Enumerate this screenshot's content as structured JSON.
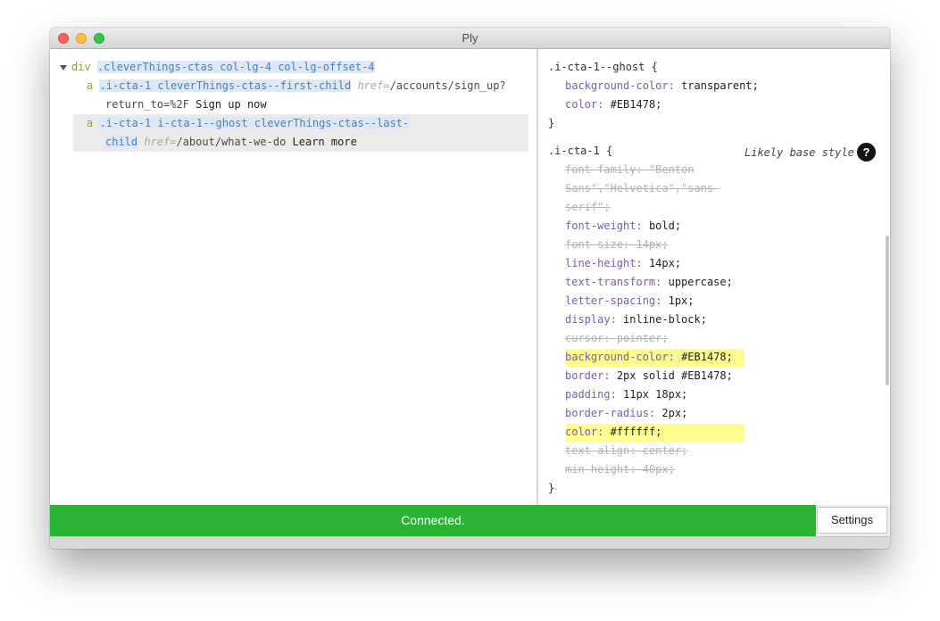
{
  "window": {
    "title": "Ply"
  },
  "dom_tree": {
    "root": {
      "tag": "div",
      "classes": ".cleverThings-ctas col-lg-4 col-lg-offset-4"
    },
    "child1": {
      "tag": "a",
      "classes": ".i-cta-1 cleverThings-ctas--first-child",
      "href_key": "href=",
      "href_val_1": "/accounts/sign_up?",
      "href_val_2": "return_to=%2F",
      "text": "Sign up now"
    },
    "child2": {
      "tag": "a",
      "classes_1": ".i-cta-1 i-cta-1--ghost cleverThings-ctas--last-",
      "classes_2": "child",
      "href_key": "href=",
      "href_val": "/about/what-we-do",
      "text": "Learn more"
    }
  },
  "styles": {
    "rule1": {
      "selector": ".i-cta-1--ghost {",
      "decls": [
        {
          "prop": "background-color:",
          "val": "transparent;"
        },
        {
          "prop": "color:",
          "val": "#EB1478;"
        }
      ],
      "close": "}"
    },
    "rule2": {
      "selector": ".i-cta-1 {",
      "note": "Likely base style",
      "help": "?",
      "font_family_1": "font-family: \"Benton",
      "font_family_2": "Sans\",\"Helvetica\",\"sans-",
      "font_family_3": "serif\";",
      "decls": [
        {
          "prop": "font-weight:",
          "val": "bold;"
        },
        {
          "prop": "font-size:",
          "val": "14px;"
        },
        {
          "prop": "line-height:",
          "val": "14px;"
        },
        {
          "prop": "text-transform:",
          "val": "uppercase;"
        },
        {
          "prop": "letter-spacing:",
          "val": "1px;"
        },
        {
          "prop": "display:",
          "val": "inline-block;"
        },
        {
          "prop": "cursor:",
          "val": "pointer;"
        },
        {
          "prop": "background-color:",
          "val": "#EB1478;"
        },
        {
          "prop": "border:",
          "val": "2px solid #EB1478;"
        },
        {
          "prop": "padding:",
          "val": "11px 18px;"
        },
        {
          "prop": "border-radius:",
          "val": "2px;"
        },
        {
          "prop": "color:",
          "val": "#ffffff;"
        },
        {
          "prop": "text-align:",
          "val": "center;"
        },
        {
          "prop": "min-height:",
          "val": "40px;"
        }
      ],
      "close": "}"
    }
  },
  "status": {
    "text": "Connected.",
    "settings_label": "Settings"
  },
  "colors": {
    "status_green": "#2ab335",
    "highlight_yellow": "#fdfd8f",
    "class_blue": "#4a7fc1",
    "property_purple": "#7a5bb5"
  }
}
